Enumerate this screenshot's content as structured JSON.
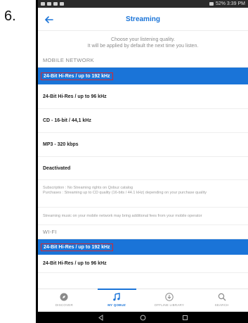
{
  "step": {
    "number": "6."
  },
  "status_bar": {
    "right_text": "52% 3:39 PM"
  },
  "app": {
    "title": "Streaming"
  },
  "intro": {
    "line1": "Choose your listening quality.",
    "line2": "It will be applied by default the next time you listen."
  },
  "mobile": {
    "header": "MOBILE NETWORK",
    "options": [
      {
        "label": "24-Bit Hi-Res / up to 192 kHz"
      },
      {
        "label": "24-Bit Hi-Res / up to 96 kHz"
      },
      {
        "label": "CD - 16-bit / 44,1 kHz"
      },
      {
        "label": "MP3 - 320 kbps"
      },
      {
        "label": "Deactivated"
      }
    ],
    "subscription_line1": "Subscription : No Streaming rights on Qobuz catalog",
    "subscription_line2": "Purchases : Streaming up to CD quality (16-bits / 44.1 kHz) depending on your purchase quality",
    "fees_note": "Streaming music on your mobile network may bring additional fees from your mobile operator"
  },
  "wifi": {
    "header": "WI-FI",
    "options": [
      {
        "label": "24-Bit Hi-Res / up to 192 kHz"
      },
      {
        "label": "24-Bit Hi-Res / up to 96 kHz"
      }
    ]
  },
  "nav": {
    "items": [
      {
        "label": "DISCOVER",
        "icon": "compass-icon"
      },
      {
        "label": "MY QOBUZ",
        "icon": "music-note-icon"
      },
      {
        "label": "OFFLINE LIBRARY",
        "icon": "download-icon"
      },
      {
        "label": "SEARCH",
        "icon": "search-icon"
      }
    ]
  },
  "colors": {
    "accent": "#1a74d8",
    "highlight_border": "#d6282d",
    "status_bar": "#2b2b2b"
  }
}
